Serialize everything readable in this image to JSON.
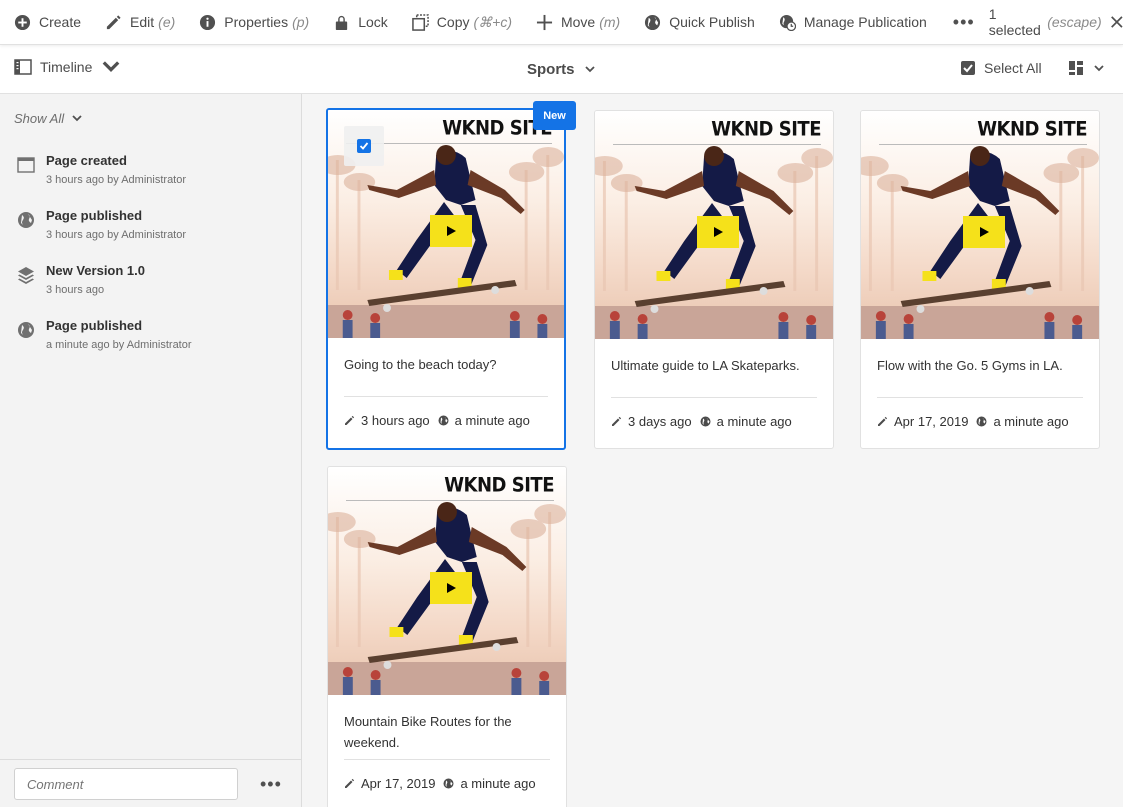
{
  "actionbar": {
    "items": [
      {
        "label": "Create",
        "hint": "",
        "icon": "add-circle-icon"
      },
      {
        "label": "Edit",
        "hint": "(e)",
        "icon": "pencil-icon"
      },
      {
        "label": "Properties",
        "hint": "(p)",
        "icon": "info-icon"
      },
      {
        "label": "Lock",
        "hint": "",
        "icon": "lock-icon"
      },
      {
        "label": "Copy",
        "hint": "(⌘+c)",
        "icon": "copy-icon"
      },
      {
        "label": "Move",
        "hint": "(m)",
        "icon": "move-icon"
      },
      {
        "label": "Quick Publish",
        "hint": "",
        "icon": "globe-icon"
      },
      {
        "label": "Manage Publication",
        "hint": "",
        "icon": "globe-clock-icon"
      }
    ],
    "more": "•••",
    "selection": "1 selected",
    "selection_hint": "(escape)"
  },
  "header": {
    "rail_label": "Timeline",
    "title": "Sports",
    "select_all": "Select All"
  },
  "rail": {
    "filter": "Show All",
    "items": [
      {
        "title": "Page created",
        "sub": "3 hours ago by Administrator",
        "icon": "page-icon"
      },
      {
        "title": "Page published",
        "sub": "3 hours ago by Administrator",
        "icon": "globe-icon"
      },
      {
        "title": "New Version 1.0",
        "sub": "3 hours ago",
        "icon": "layers-icon"
      },
      {
        "title": "Page published",
        "sub": "a minute ago by Administrator",
        "icon": "globe-icon"
      }
    ],
    "comment_placeholder": "Comment",
    "more": "•••"
  },
  "cards": [
    {
      "title": "Going to the beach today?",
      "modified": "3 hours ago",
      "published": "a minute ago",
      "brand": "WKND SITE",
      "badge": "New",
      "selected": true
    },
    {
      "title": "Ultimate guide to LA Skateparks.",
      "modified": "3 days ago",
      "published": "a minute ago",
      "brand": "WKND SITE"
    },
    {
      "title": "Flow with the Go. 5 Gyms in LA.",
      "modified": "Apr 17, 2019",
      "published": "a minute ago",
      "brand": "WKND SITE"
    },
    {
      "title": "Mountain Bike Routes for the weekend.",
      "modified": "Apr 17, 2019",
      "published": "a minute ago",
      "brand": "WKND SITE"
    }
  ],
  "colors": {
    "accent": "#1473e6",
    "play": "#f5e11a"
  }
}
